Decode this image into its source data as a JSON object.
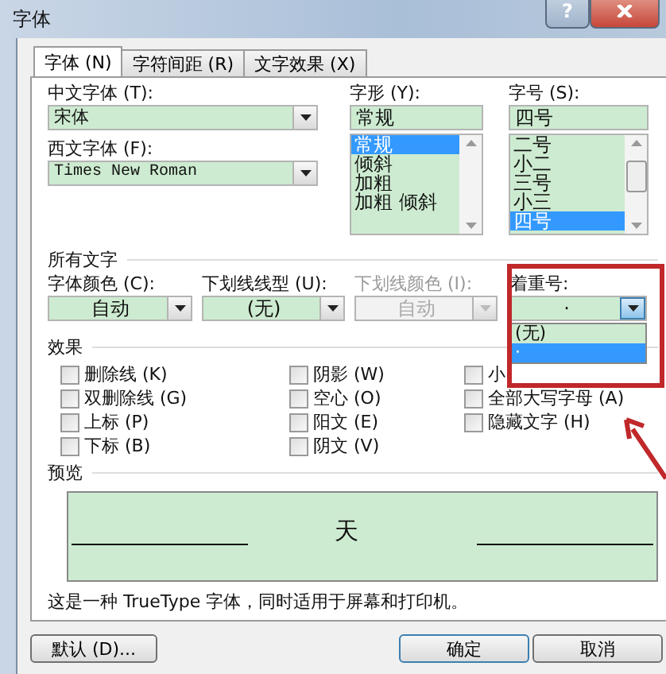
{
  "window": {
    "title": "字体",
    "help": "?"
  },
  "tabs": [
    {
      "label": "字体 (N)",
      "selected": true
    },
    {
      "label": "字符间距 (R)",
      "selected": false
    },
    {
      "label": "文字效果 (X)",
      "selected": false
    }
  ],
  "chinese_font": {
    "label": "中文字体 (T):",
    "value": "宋体"
  },
  "western_font": {
    "label": "西文字体 (F):",
    "value": "Times New Roman"
  },
  "style": {
    "label": "字形 (Y):",
    "value": "常规",
    "options": [
      {
        "label": "常规",
        "selected": true
      },
      {
        "label": "倾斜",
        "selected": false
      },
      {
        "label": "加粗",
        "selected": false
      },
      {
        "label": "加粗 倾斜",
        "selected": false
      }
    ]
  },
  "size": {
    "label": "字号 (S):",
    "value": "四号",
    "options": [
      {
        "label": "二号",
        "selected": false
      },
      {
        "label": "小二",
        "selected": false
      },
      {
        "label": "三号",
        "selected": false
      },
      {
        "label": "小三",
        "selected": false
      },
      {
        "label": "四号",
        "selected": true
      }
    ]
  },
  "all_text": {
    "heading": "所有文字",
    "combos": [
      {
        "label": "字体颜色 (C):",
        "value": "自动",
        "disabled": false
      },
      {
        "label": "下划线线型 (U):",
        "value": "(无)",
        "disabled": false
      },
      {
        "label": "下划线颜色 (I):",
        "value": "自动",
        "disabled": true
      },
      {
        "label": "着重号:",
        "value": "·",
        "disabled": false,
        "expanded": true,
        "options": [
          {
            "label": "(无)",
            "selected": false
          },
          {
            "label": "·",
            "selected": true
          }
        ]
      }
    ]
  },
  "effects": {
    "heading": "效果",
    "columns": [
      [
        {
          "label": "删除线 (K)",
          "checked": false
        },
        {
          "label": "双删除线 (G)",
          "checked": false
        },
        {
          "label": "上标 (P)",
          "checked": false
        },
        {
          "label": "下标 (B)",
          "checked": false
        }
      ],
      [
        {
          "label": "阴影 (W)",
          "checked": false
        },
        {
          "label": "空心 (O)",
          "checked": false
        },
        {
          "label": "阳文 (E)",
          "checked": false
        },
        {
          "label": "阴文 (V)",
          "checked": false
        }
      ],
      [
        {
          "label": "小",
          "checked": false
        },
        {
          "label": "全部大写字母 (A)",
          "checked": false
        },
        {
          "label": "隐藏文字 (H)",
          "checked": false
        }
      ]
    ]
  },
  "preview": {
    "heading": "预览",
    "sample": "天"
  },
  "description": "这是一种 TrueType 字体，同时适用于屏幕和打印机。",
  "buttons": {
    "default": "默认 (D)...",
    "ok": "确定",
    "cancel": "取消"
  }
}
